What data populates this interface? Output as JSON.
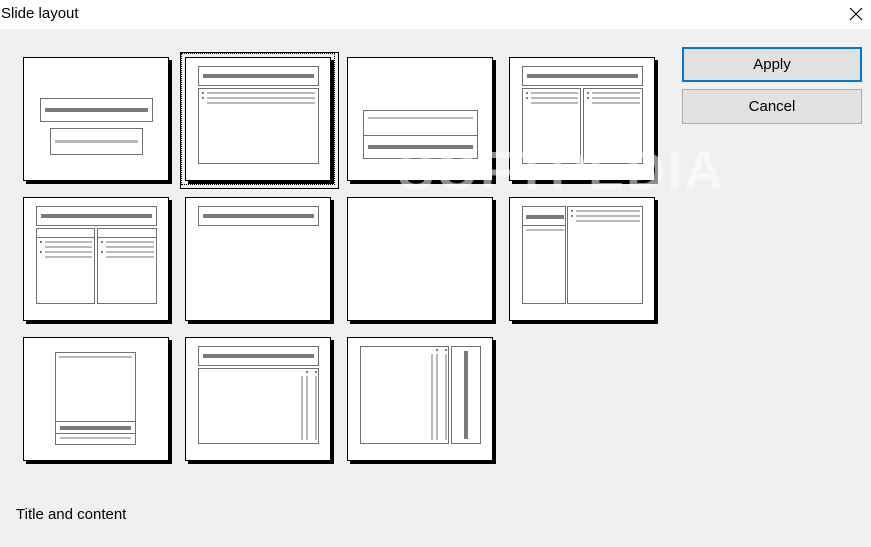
{
  "window": {
    "title": "Slide layout",
    "close_icon": "close-icon"
  },
  "buttons": {
    "apply_label": "Apply",
    "cancel_label": "Cancel"
  },
  "status": {
    "selected_layout_name": "Title and content"
  },
  "watermark": {
    "text": "SOFTPEDIA"
  },
  "layouts": [
    {
      "id": "title-slide"
    },
    {
      "id": "title-and-content",
      "selected": true
    },
    {
      "id": "section-header"
    },
    {
      "id": "two-content"
    },
    {
      "id": "two-content-with-title-bars"
    },
    {
      "id": "title-only"
    },
    {
      "id": "blank"
    },
    {
      "id": "content-with-caption"
    },
    {
      "id": "picture-with-caption"
    },
    {
      "id": "title-and-vertical-text"
    },
    {
      "id": "vertical-title-and-text"
    }
  ]
}
